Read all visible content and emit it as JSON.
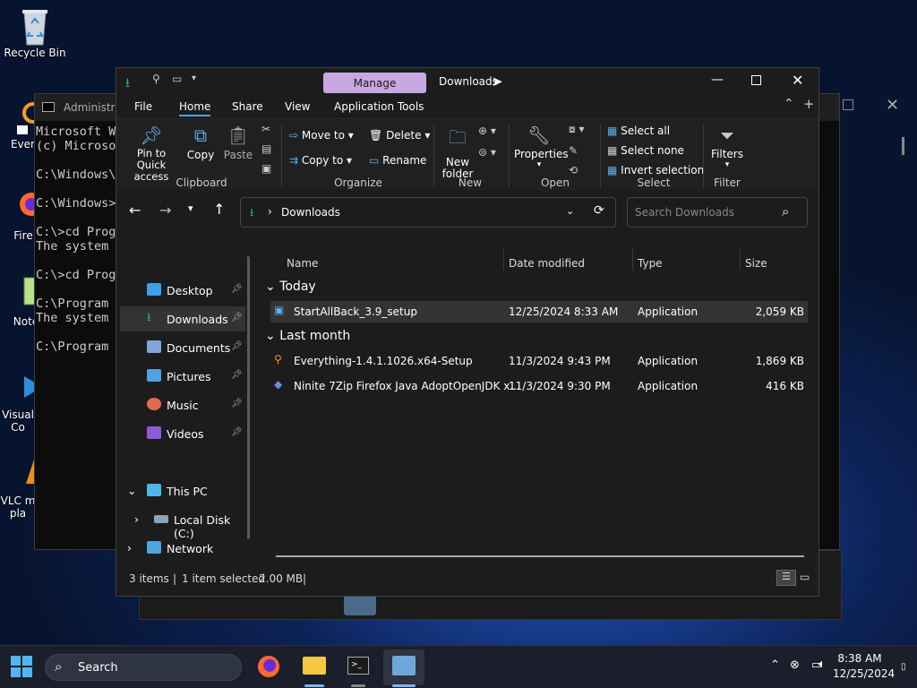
{
  "desktop": {
    "icons": [
      {
        "label": "Recycle Bin"
      },
      {
        "label": "Every"
      },
      {
        "label": "Fire"
      },
      {
        "label": "Note"
      },
      {
        "label": "Visual Co"
      },
      {
        "label": "VLC m pla"
      }
    ]
  },
  "cmd": {
    "title": "Administra",
    "lines": "Microsoft Wi\n(c) Microso\n\nC:\\Windows\\S\n\nC:\\Windows>c\n\nC:\\>cd Progr\nThe system c\n\nC:\\>cd Progr\n\nC:\\Program F\nThe system c\n\nC:\\Program F"
  },
  "explorer": {
    "title": "Downloads",
    "manage_label": "Manage",
    "tabs": [
      "File",
      "Home",
      "Share",
      "View",
      "Application Tools"
    ],
    "ribbon": {
      "pin": "Pin to Quick access",
      "copy": "Copy",
      "paste": "Paste",
      "move_to": "Move to",
      "copy_to": "Copy to",
      "delete": "Delete",
      "rename": "Rename",
      "new_folder": "New folder",
      "properties": "Properties",
      "select_all": "Select all",
      "select_none": "Select none",
      "invert_selection": "Invert selection",
      "filters": "Filters",
      "groups": [
        "Clipboard",
        "Organize",
        "New",
        "Open",
        "Select",
        "Filter"
      ]
    },
    "address": {
      "path": "Downloads",
      "search_placeholder": "Search Downloads"
    },
    "nav": {
      "quick": [
        {
          "label": "Desktop",
          "color": "#3aa0e8"
        },
        {
          "label": "Downloads",
          "color": "#2bb673"
        },
        {
          "label": "Documents",
          "color": "#7da7d9"
        },
        {
          "label": "Pictures",
          "color": "#4fa3e0"
        },
        {
          "label": "Music",
          "color": "#e06c4f"
        },
        {
          "label": "Videos",
          "color": "#8e5bd6"
        }
      ],
      "this_pc": "This PC",
      "local_disk": "Local Disk (C:)",
      "network": "Network"
    },
    "columns": [
      "Name",
      "Date modified",
      "Type",
      "Size"
    ],
    "groups": [
      {
        "label": "Today",
        "files": [
          {
            "name": "StartAllBack_3.9_setup",
            "date": "12/25/2024 8:33 AM",
            "type": "Application",
            "size": "2,059 KB",
            "selected": true
          }
        ]
      },
      {
        "label": "Last month",
        "files": [
          {
            "name": "Everything-1.4.1.1026.x64-Setup",
            "date": "11/3/2024 9:43 PM",
            "type": "Application",
            "size": "1,869 KB"
          },
          {
            "name": "Ninite 7Zip Firefox Java AdoptOpenJDK x...",
            "date": "11/3/2024 9:30 PM",
            "type": "Application",
            "size": "416 KB"
          }
        ]
      }
    ],
    "status": {
      "items": "3 items",
      "selected": "1 item selected",
      "size": "2.00 MB"
    }
  },
  "taskbar": {
    "search_label": "Search",
    "time": "8:38 AM",
    "date": "12/25/2024"
  },
  "colors": {
    "accent": "#2b9a6f",
    "manage": "#c8a8e0",
    "selection": "#333333"
  }
}
